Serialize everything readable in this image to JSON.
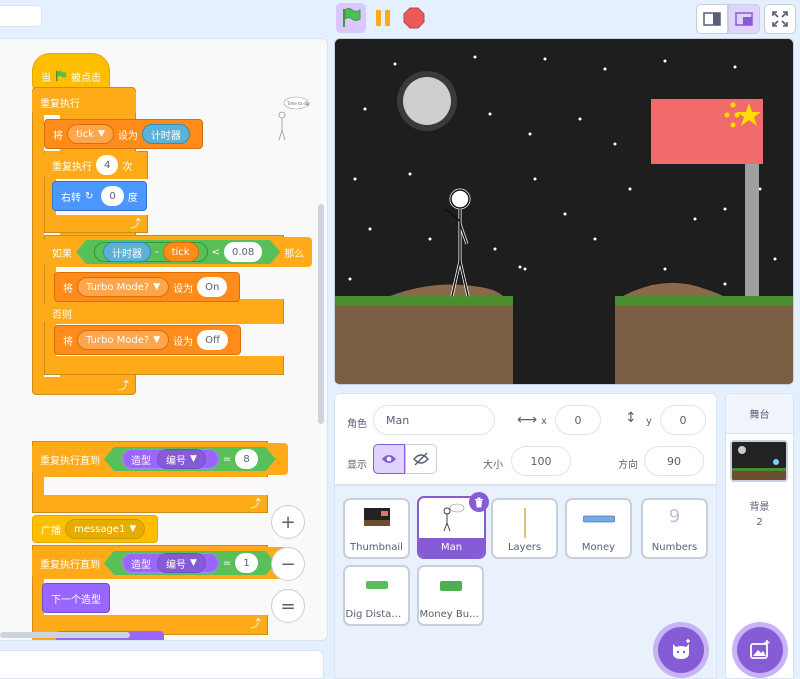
{
  "script1": {
    "hat_label": "当",
    "hat_label2": "被点击",
    "forever": "重复执行",
    "set_label": "将",
    "set_to": "设为",
    "var_tick": "tick",
    "timer": "计时器",
    "repeat": "重复执行",
    "repeat_count": "4",
    "repeat_times": "次",
    "turn": "右转",
    "turn_value": "0",
    "turn_unit": "度",
    "if": "如果",
    "minus": "-",
    "lt": "<",
    "threshold": "0.08",
    "then": "那么",
    "turbo_var": "Turbo Mode?",
    "on_value": "On",
    "else": "否则",
    "off_value": "Off"
  },
  "script2": {
    "repeat_until": "重复执行直到",
    "costume": "造型",
    "number": "编号",
    "eq": "=",
    "value8": "8",
    "broadcast": "广播",
    "message": "message1",
    "value1": "1",
    "next_costume": "下一个造型"
  },
  "zoom": {
    "in": "+",
    "out": "−",
    "reset": "="
  },
  "sprite_info": {
    "sprite_label": "角色",
    "sprite_name": "Man",
    "x_label": "x",
    "x_value": "0",
    "y_label": "y",
    "y_value": "0",
    "show_label": "显示",
    "size_label": "大小",
    "size_value": "100",
    "direction_label": "方向",
    "direction_value": "90"
  },
  "sprites": [
    {
      "name": "Thumbnail",
      "selected": false
    },
    {
      "name": "Man",
      "selected": true
    },
    {
      "name": "Layers",
      "selected": false
    },
    {
      "name": "Money",
      "selected": false
    },
    {
      "name": "Numbers",
      "selected": false
    },
    {
      "name": "Dig Distan…",
      "selected": false
    },
    {
      "name": "Money But…",
      "selected": false
    }
  ],
  "stage_panel": {
    "title": "舞台",
    "backdrop_label": "背景",
    "backdrop_count": "2"
  },
  "sprite_thumb_text": "Time to dig",
  "colors": {
    "accent": "#855cd6",
    "events": "#ffbf00",
    "control": "#ffab19",
    "variables": "#ff8c1a",
    "motion": "#4c97ff",
    "looks": "#9966ff",
    "operators": "#59c059",
    "flag_red": "#f26b6b"
  }
}
